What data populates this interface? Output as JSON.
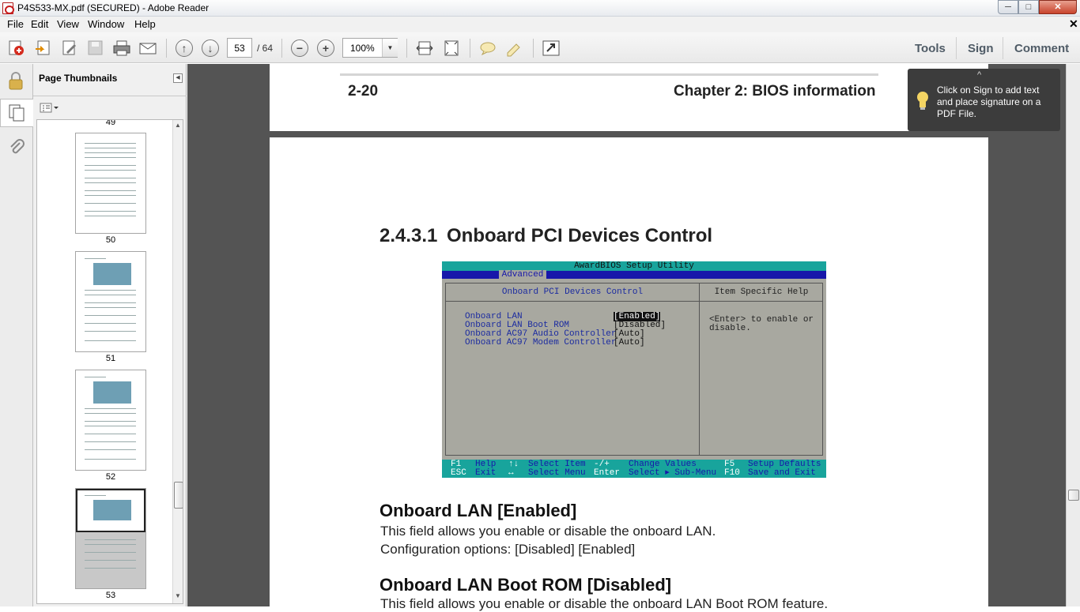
{
  "window": {
    "title": "P4S533-MX.pdf (SECURED) - Adobe Reader",
    "min": "─",
    "max": "□",
    "close": "✕"
  },
  "menu": {
    "items": [
      "File",
      "Edit",
      "View",
      "Window",
      "Help"
    ],
    "close": "✕"
  },
  "toolbar": {
    "page_current": "53",
    "page_total": "/ 64",
    "zoom": "100%",
    "right_links": [
      "Tools",
      "Sign",
      "Comment"
    ],
    "icons": [
      "create-pdf-icon",
      "export-pdf-icon",
      "edit-pdf-icon",
      "save-icon",
      "print-icon",
      "email-icon",
      "previous-page-icon",
      "next-page-icon",
      "zoom-out-icon",
      "zoom-in-icon",
      "fit-width-icon",
      "fit-page-icon",
      "comment-icon",
      "highlight-icon",
      "full-screen-icon"
    ]
  },
  "nav": {
    "title": "Page Thumbnails",
    "thumbnails": [
      {
        "label": "49",
        "selected": false
      },
      {
        "label": "50",
        "selected": false
      },
      {
        "label": "51",
        "selected": false
      },
      {
        "label": "52",
        "selected": false
      },
      {
        "label": "53",
        "selected": true
      }
    ]
  },
  "page_header": {
    "left": "2-20",
    "right": "Chapter 2: BIOS information"
  },
  "section": {
    "number": "2.4.3.1",
    "title": "Onboard PCI Devices Control"
  },
  "bios": {
    "utility": "AwardBIOS Setup Utility",
    "tab": "Advanced",
    "box_title": "Onboard PCI Devices Control",
    "help_title": "Item Specific Help",
    "items": [
      {
        "label": "Onboard LAN",
        "value": "[Enabled]"
      },
      {
        "label": "Onboard LAN Boot ROM",
        "value": "[Disabled]"
      },
      {
        "label": "Onboard AC97 Audio Controller",
        "value": "[Auto]"
      },
      {
        "label": "Onboard AC97 Modem Controller",
        "value": "[Auto]"
      }
    ],
    "help_text": "<Enter> to enable or disable.",
    "footer": {
      "f1": "F1",
      "help": "Help",
      "updown": "↑↓",
      "select_item": "Select Item",
      "minusplus": "-/+",
      "change_values": "Change Values",
      "f5": "F5",
      "setup_defaults": "Setup Defaults",
      "esc": "ESC",
      "exit": "Exit",
      "leftright": "↔",
      "select_menu": "Select Menu",
      "enter": "Enter",
      "select_submenu": "Select ▸ Sub-Menu",
      "f10": "F10",
      "save_exit": "Save and Exit"
    }
  },
  "body": {
    "h_lan": "Onboard LAN [Enabled]",
    "p_lan1": "This field allows you enable or disable the onboard LAN.",
    "p_lan2": "Configuration options: [Disabled] [Enabled]",
    "h_bootrom": "Onboard LAN Boot ROM [Disabled]",
    "p_bootrom1": "This field allows you enable or disable the onboard LAN Boot ROM feature."
  },
  "tooltip": {
    "text": "Click on Sign to add text and place signature on a PDF File.",
    "close": "^"
  }
}
